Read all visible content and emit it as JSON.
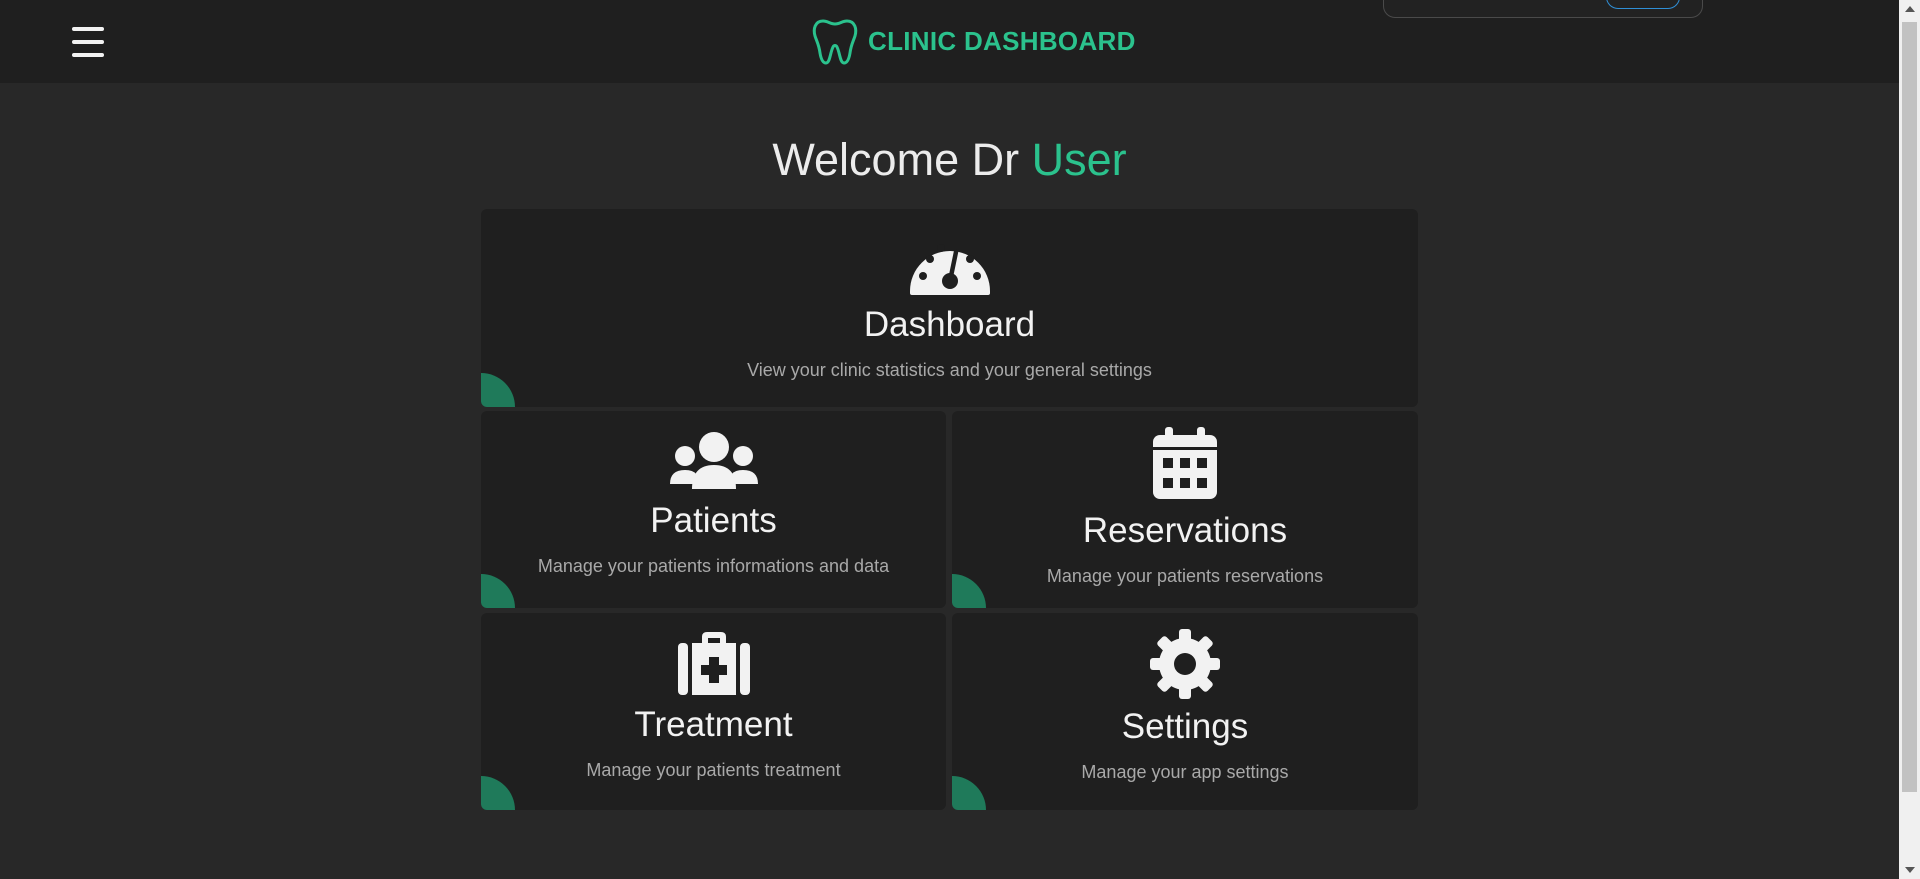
{
  "header": {
    "menu_icon": "hamburger-menu-icon",
    "logo_icon": "tooth-icon",
    "title": "CLINIC DASHBOARD"
  },
  "welcome": {
    "prefix": "Welcome Dr ",
    "name": "User"
  },
  "cards": [
    {
      "icon": "gauge-icon",
      "title": "Dashboard",
      "description": "View your clinic statistics and your general settings"
    },
    {
      "icon": "users-icon",
      "title": "Patients",
      "description": "Manage your patients informations and data"
    },
    {
      "icon": "calendar-icon",
      "title": "Reservations",
      "description": "Manage your patients reservations"
    },
    {
      "icon": "medkit-icon",
      "title": "Treatment",
      "description": "Manage your patients treatment"
    },
    {
      "icon": "gear-icon",
      "title": "Settings",
      "description": "Manage your app settings"
    }
  ],
  "colors": {
    "accent": "#2bc28d",
    "corner": "#1f7a5a",
    "background": "#282828",
    "card": "#1f1f1f",
    "header": "#1f1f1f"
  }
}
